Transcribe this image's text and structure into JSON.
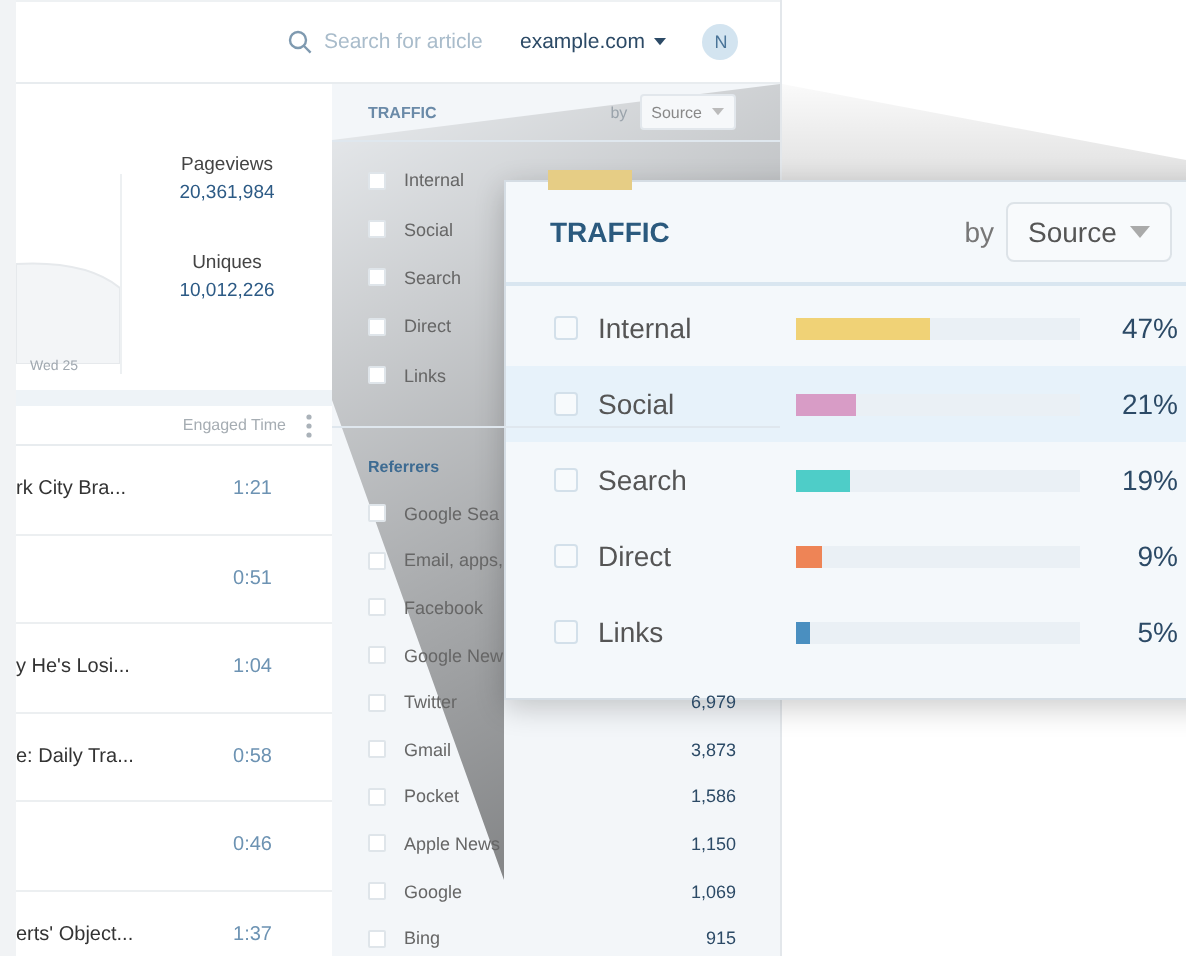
{
  "topbar": {
    "search_placeholder": "Search for article",
    "site": "example.com",
    "avatar": "N"
  },
  "stats": {
    "chart_label": "Wed 25",
    "metrics": [
      {
        "label": "Pageviews",
        "value": "20,361,984"
      },
      {
        "label": "Uniques",
        "value": "10,012,226"
      }
    ]
  },
  "table": {
    "column": "Engaged Time",
    "rows": [
      {
        "title": "rk City Bra...",
        "time": "1:21"
      },
      {
        "time": "0:51"
      },
      {
        "title": "y He's Losi...",
        "time": "1:04"
      },
      {
        "title": "e: Daily Tra...",
        "time": "0:58"
      },
      {
        "time": "0:46"
      },
      {
        "title": "erts' Object...",
        "time": "1:37"
      }
    ]
  },
  "traffic": {
    "title": "TRAFFIC",
    "by": "by",
    "dropdown": "Source",
    "sources": [
      {
        "name": "Internal",
        "checked": false
      },
      {
        "name": "Social",
        "checked": false
      },
      {
        "name": "Search",
        "checked": false
      },
      {
        "name": "Direct",
        "checked": false
      },
      {
        "name": "Links",
        "checked": false
      }
    ],
    "referrers_title": "Referrers",
    "referrers": [
      {
        "name": "Google Sea",
        "checked": false
      },
      {
        "name": "Email, apps,",
        "checked": false
      },
      {
        "name": "Facebook",
        "checked": false
      },
      {
        "name": "Google New",
        "checked": false
      },
      {
        "name": "Twitter",
        "checked": false,
        "count": "6,979"
      },
      {
        "name": "Gmail",
        "checked": false,
        "count": "3,873"
      },
      {
        "name": "Pocket",
        "checked": false,
        "count": "1,586"
      },
      {
        "name": "Apple News",
        "checked": false,
        "count": "1,150"
      },
      {
        "name": "Google",
        "checked": false,
        "count": "1,069"
      },
      {
        "name": "Bing",
        "checked": false,
        "count": "915"
      }
    ]
  },
  "popup": {
    "title": "TRAFFIC",
    "by": "by",
    "dropdown": "Source",
    "rows": [
      {
        "name": "Internal",
        "checked": false,
        "selected": false,
        "level": 0.47,
        "color": "#f0d276",
        "share": "47%"
      },
      {
        "name": "Social",
        "checked": false,
        "selected": true,
        "level": 0.21,
        "color": "#d89cc6",
        "share": "21%"
      },
      {
        "name": "Search",
        "checked": false,
        "selected": false,
        "level": 0.19,
        "color": "#4ecdc8",
        "share": "19%"
      },
      {
        "name": "Direct",
        "checked": false,
        "selected": false,
        "level": 0.09,
        "color": "#ee8456",
        "share": "9%"
      },
      {
        "name": "Links",
        "checked": false,
        "selected": false,
        "level": 0.05,
        "color": "#4a8fc0",
        "share": "5%"
      }
    ]
  }
}
